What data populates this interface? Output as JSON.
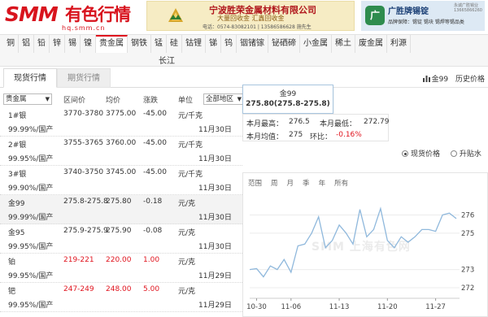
{
  "header": {
    "logo_mark": "SMM",
    "logo_cn": "有色行情",
    "logo_url": "hq.smm.cn",
    "ad1_title": "宁波胜荣金属材料有限公司",
    "ad1_sub": "大量回收金 汇鑫回收金",
    "ad1_tel": "电话：0574-83082101 | 13586586628 施先生",
    "ad2_icon": "广",
    "ad2_title": "广胜牌锡锭",
    "ad2_small": "永诚广胜锡业\n13665866260",
    "ad2_desc": "品牌保障：锡锭 锡块 锡焊等锡品类"
  },
  "nav": {
    "items": [
      "铜",
      "铝",
      "铅",
      "锌",
      "锡",
      "镍",
      "贵金属",
      "钢铁",
      "锰",
      "硅",
      "钴锂",
      "锑",
      "钨",
      "铟锗镓",
      "铋硒碲",
      "小金属",
      "稀土",
      "废金属",
      "利源"
    ],
    "active_index": 6,
    "sub": "长江"
  },
  "tabs": {
    "spot": "现货行情",
    "futures": "期货行情"
  },
  "table": {
    "category_select": "贵金属",
    "region_select": "全部地区",
    "headers": {
      "range": "区间价",
      "avg": "均价",
      "change": "涨跌",
      "unit": "单位"
    },
    "rows": [
      {
        "name": "1#银",
        "spec": "99.99%/国产",
        "range": "3770-3780",
        "avg": "3775.00",
        "change": "-45.00",
        "unit": "元/千克",
        "date": "11月30日",
        "trend": "down"
      },
      {
        "name": "2#银",
        "spec": "99.95%/国产",
        "range": "3755-3765",
        "avg": "3760.00",
        "change": "-45.00",
        "unit": "元/千克",
        "date": "11月30日",
        "trend": "down"
      },
      {
        "name": "3#银",
        "spec": "99.90%/国产",
        "range": "3740-3750",
        "avg": "3745.00",
        "change": "-45.00",
        "unit": "元/千克",
        "date": "11月30日",
        "trend": "down"
      },
      {
        "name": "金99",
        "spec": "99.99%/国产",
        "range": "275.8-275.8",
        "avg": "275.80",
        "change": "-0.18",
        "unit": "元/克",
        "date": "11月30日",
        "trend": "down"
      },
      {
        "name": "金95",
        "spec": "99.95%/国产",
        "range": "275.9-275.9",
        "avg": "275.90",
        "change": "-0.08",
        "unit": "元/克",
        "date": "11月30日",
        "trend": "down"
      },
      {
        "name": "铂",
        "spec": "99.95%/国产",
        "range": "219-221",
        "avg": "220.00",
        "change": "1.00",
        "unit": "元/克",
        "date": "11月29日",
        "trend": "up"
      },
      {
        "name": "钯",
        "spec": "99.95%/国产",
        "range": "247-249",
        "avg": "248.00",
        "change": "5.00",
        "unit": "元/克",
        "date": "11月29日",
        "trend": "up"
      }
    ]
  },
  "detail": {
    "links": {
      "gold": "金99",
      "history": "历史价格"
    },
    "card_name": "金99",
    "card_price": "275.80(275.8-275.8)",
    "month_high_label": "本月最高：",
    "month_high": "276.5",
    "month_low_label": "本月最低：",
    "month_low": "272.79",
    "month_avg_label": "本月均值：",
    "month_avg": "275",
    "mom_label": "环比：",
    "mom": "-0.16%",
    "radio_spot": "现货价格",
    "radio_premium": "升贴水",
    "ranges": [
      "范围",
      "周",
      "月",
      "季",
      "年",
      "所有"
    ],
    "watermark": "SMM 上海有色网"
  },
  "colors": {
    "brand_red": "#d8141e",
    "down_green": "#0a8a2a",
    "up_red": "#e0141e",
    "line": "#8fb8dc"
  },
  "chart_data": {
    "type": "line",
    "x_tick_labels": [
      "10-30",
      "11-06",
      "11-13",
      "11-20",
      "11-27"
    ],
    "y_tick_labels": [
      "272",
      "273",
      "275",
      "276"
    ],
    "ylim": [
      271.6,
      276.6
    ],
    "series": [
      {
        "values": [
          273.0,
          273.05,
          272.6,
          273.2,
          273.0,
          273.55,
          272.85,
          274.3,
          274.4,
          275.0,
          275.9,
          274.2,
          274.6,
          275.45,
          275.0,
          274.4,
          276.3,
          274.8,
          275.2,
          276.35,
          274.6,
          274.2,
          274.8,
          274.5,
          274.8,
          275.2,
          275.2,
          275.1,
          276.0,
          276.1,
          275.8
        ]
      }
    ]
  }
}
